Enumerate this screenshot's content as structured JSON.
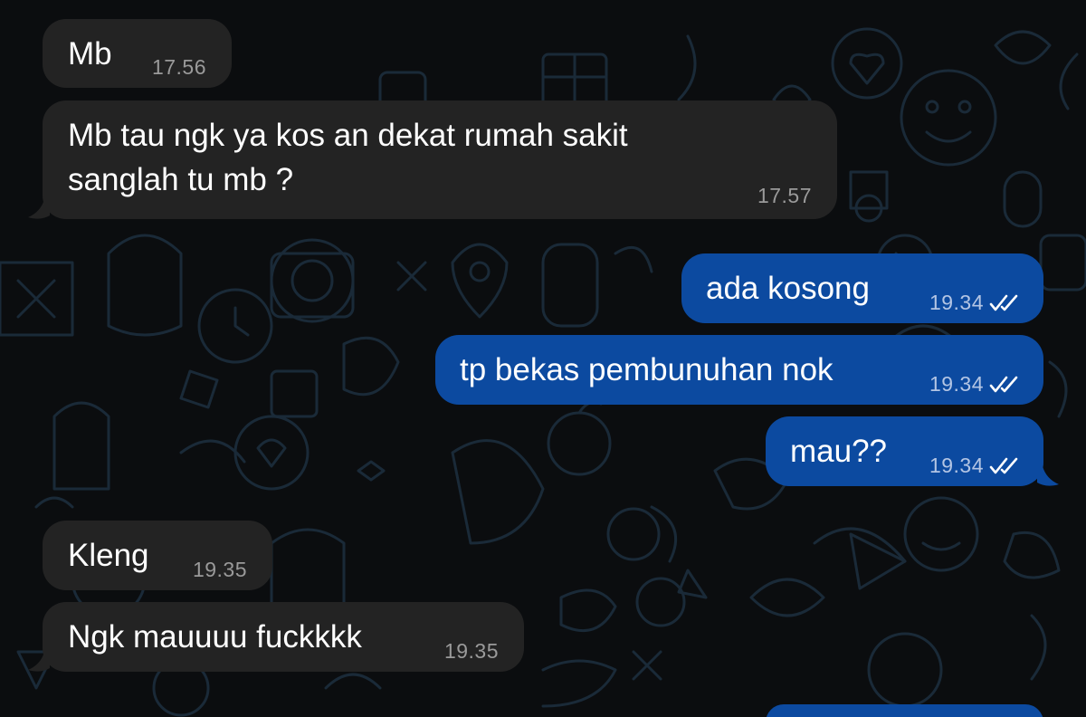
{
  "chat": {
    "background_color": "#0b0d0f",
    "incoming_bubble_color": "#232323",
    "outgoing_bubble_color": "#0c4aa0",
    "messages": [
      {
        "direction": "incoming",
        "text": "Mb",
        "time": "17.56"
      },
      {
        "direction": "incoming",
        "text": "Mb tau ngk ya kos an dekat rumah sakit\nsanglah tu mb ?",
        "time": "17.57"
      },
      {
        "direction": "outgoing",
        "text": "ada kosong",
        "time": "19.34",
        "status": "read-ticks"
      },
      {
        "direction": "outgoing",
        "text": "tp bekas pembunuhan nok",
        "time": "19.34",
        "status": "read-ticks"
      },
      {
        "direction": "outgoing",
        "text": "mau??",
        "time": "19.34",
        "status": "read-ticks"
      },
      {
        "direction": "incoming",
        "text": "Kleng",
        "time": "19.35"
      },
      {
        "direction": "incoming",
        "text": "Ngk mauuuu fuckkkk",
        "time": "19.35"
      }
    ]
  }
}
